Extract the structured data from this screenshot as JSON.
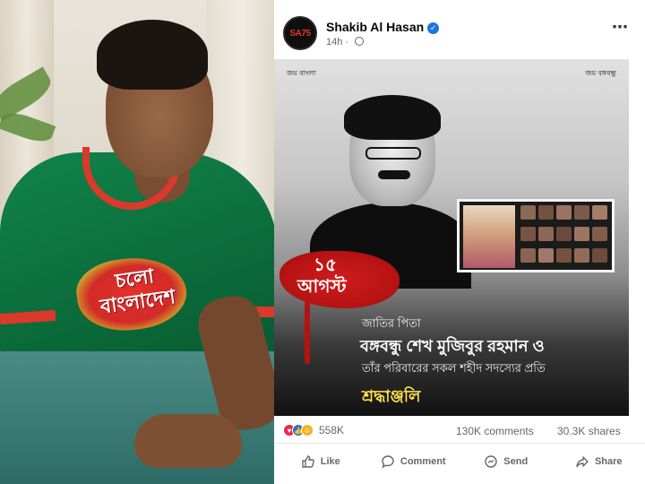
{
  "post": {
    "author": "Shakib Al Hasan",
    "avatar_text": "SA75",
    "timestamp": "14h",
    "more_icon": "⋯"
  },
  "photo": {
    "jersey_text_line1": "চলো",
    "jersey_text_line2": "বাংলাদেশ"
  },
  "poster": {
    "top_left": "জয় বাংলা",
    "top_right": "জয় বঙ্গবন্ধু",
    "date_day": "১৫",
    "date_month": "আগস্ট",
    "line1": "জাতির পিতা",
    "line2": "বঙ্গবন্ধু শেখ মুজিবুর রহমান ও",
    "line3": "তাঁর পরিবারের সকল শহীদ সদস্যের প্রতি",
    "line4": "শ্রদ্ধাঞ্জলি"
  },
  "stats": {
    "reaction_count": "558K",
    "comments": "130K comments",
    "shares": "30.3K shares"
  },
  "actions": {
    "like": "Like",
    "comment": "Comment",
    "send": "Send",
    "share": "Share"
  },
  "colors": {
    "verified": "#1b74e4",
    "jersey_green": "#0b6b3a",
    "accent_red": "#d01c1c",
    "tribute_yellow": "#ffe14a"
  }
}
